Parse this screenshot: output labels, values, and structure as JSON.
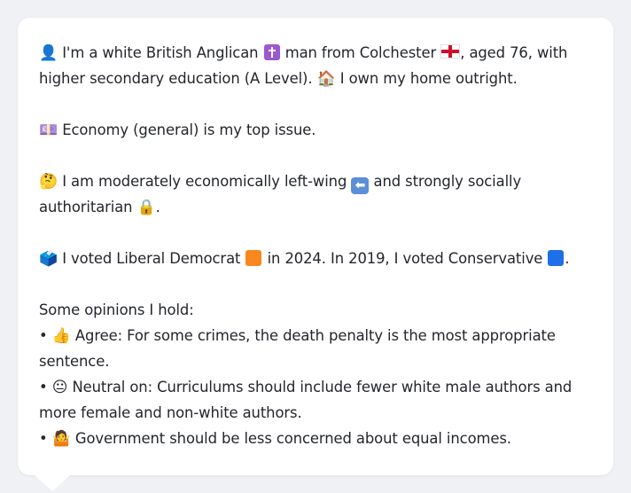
{
  "icons": {
    "person": "👤",
    "cross": "latin-cross-square",
    "england_flag": "england-flag",
    "house": "🏠",
    "money": "💷",
    "thinking": "🤔",
    "left_arrow": "⬅",
    "lock": "🔒",
    "ballot": "🗳️",
    "thumbs_up": "👍",
    "neutral_face": "😐",
    "shrug": "🤷"
  },
  "colors": {
    "lib_dem_square": "#f7871e",
    "conservative_square": "#1e6fe8",
    "cross_square": "#9b59d0"
  },
  "profile": {
    "line1_a": "I'm a white British Anglican",
    "line1_b": "man from Colchester",
    "line1_c": ", aged 76, with",
    "line1_d": "higher secondary education (A Level).",
    "line1_e": "I own my home outright.",
    "issue": "Economy (general) is my top issue.",
    "politics_a": "I am moderately economically left-wing",
    "politics_b": "and strongly socially",
    "politics_c": "authoritarian",
    "politics_d": ".",
    "vote_a": "I voted Liberal Democrat",
    "vote_b": "in 2024. In 2019, I voted Conservative",
    "vote_c": ".",
    "opinions_heading": "Some opinions I hold:",
    "bullet": "•",
    "opinion1": "Agree: For some crimes, the death penalty is the most appropriate sentence.",
    "opinion2": "Neutral on: Curriculums should include fewer white male authors and more female and non-white authors.",
    "opinion3": "Government should be less concerned about equal incomes."
  }
}
